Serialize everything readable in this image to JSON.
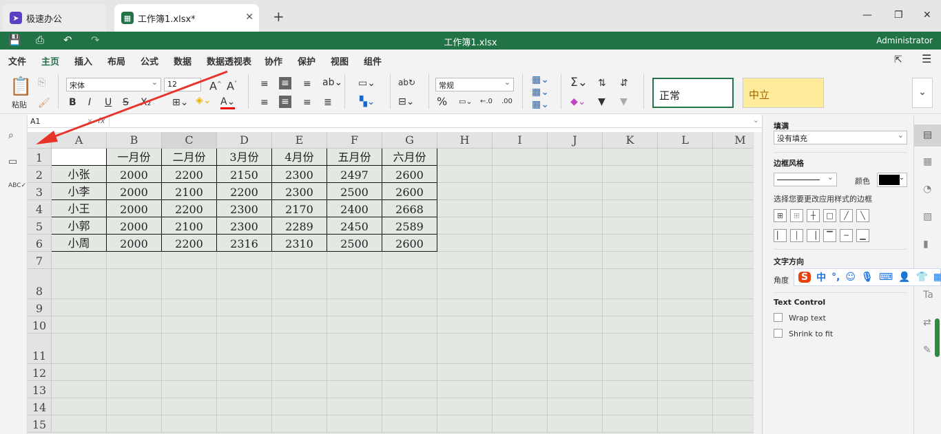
{
  "tabs": [
    {
      "label": "极速办公",
      "icon": "rocket-icon",
      "color": "#5b3fc4"
    },
    {
      "label": "工作簿1.xlsx*",
      "icon": "sheet-icon",
      "color": "#217346"
    }
  ],
  "window": {
    "title": "工作簿1.xlsx",
    "user": "Administrator"
  },
  "menu": [
    "文件",
    "主页",
    "插入",
    "布局",
    "公式",
    "数据",
    "数据透视表",
    "协作",
    "保护",
    "视图",
    "组件"
  ],
  "ribbon": {
    "paste_label": "粘贴",
    "font": "宋体",
    "size": "12",
    "number_format": "常规",
    "style_normal": "正常",
    "style_neutral": "中立"
  },
  "formula": {
    "cell_ref": "A1",
    "fx": "fx"
  },
  "grid": {
    "columns": [
      "A",
      "B",
      "C",
      "D",
      "E",
      "F",
      "G",
      "H",
      "I",
      "J",
      "K",
      "L",
      "M"
    ],
    "rows": [
      "1",
      "2",
      "3",
      "4",
      "5",
      "6",
      "7",
      "8",
      "9",
      "10",
      "11",
      "12",
      "13",
      "14",
      "15"
    ],
    "cells": [
      [
        "",
        "一月份",
        "二月份",
        "3月份",
        "4月份",
        "五月份",
        "六月份"
      ],
      [
        "小张",
        "2000",
        "2200",
        "2150",
        "2300",
        "2497",
        "2600"
      ],
      [
        "小李",
        "2000",
        "2100",
        "2200",
        "2300",
        "2500",
        "2600"
      ],
      [
        "小王",
        "2000",
        "2200",
        "2300",
        "2170",
        "2400",
        "2668"
      ],
      [
        "小郭",
        "2000",
        "2100",
        "2300",
        "2289",
        "2450",
        "2589"
      ],
      [
        "小周",
        "2000",
        "2200",
        "2316",
        "2310",
        "2500",
        "2600"
      ]
    ]
  },
  "panel": {
    "fill_title": "填满",
    "fill_value": "没有填充",
    "border_title": "边框风格",
    "color_label": "颜色",
    "border_hint": "选择您要更改应用样式的边框",
    "text_dir": "文字方向",
    "angle": "角度",
    "text_control": "Text Control",
    "wrap": "Wrap text",
    "shrink": "Shrink to fit"
  },
  "ime": {
    "lang": "中",
    "punct": "°,"
  },
  "colors": {
    "accent": "#217346",
    "neutral_fill": "#ffeb9c",
    "grid_bg": "#e3e8e3"
  }
}
